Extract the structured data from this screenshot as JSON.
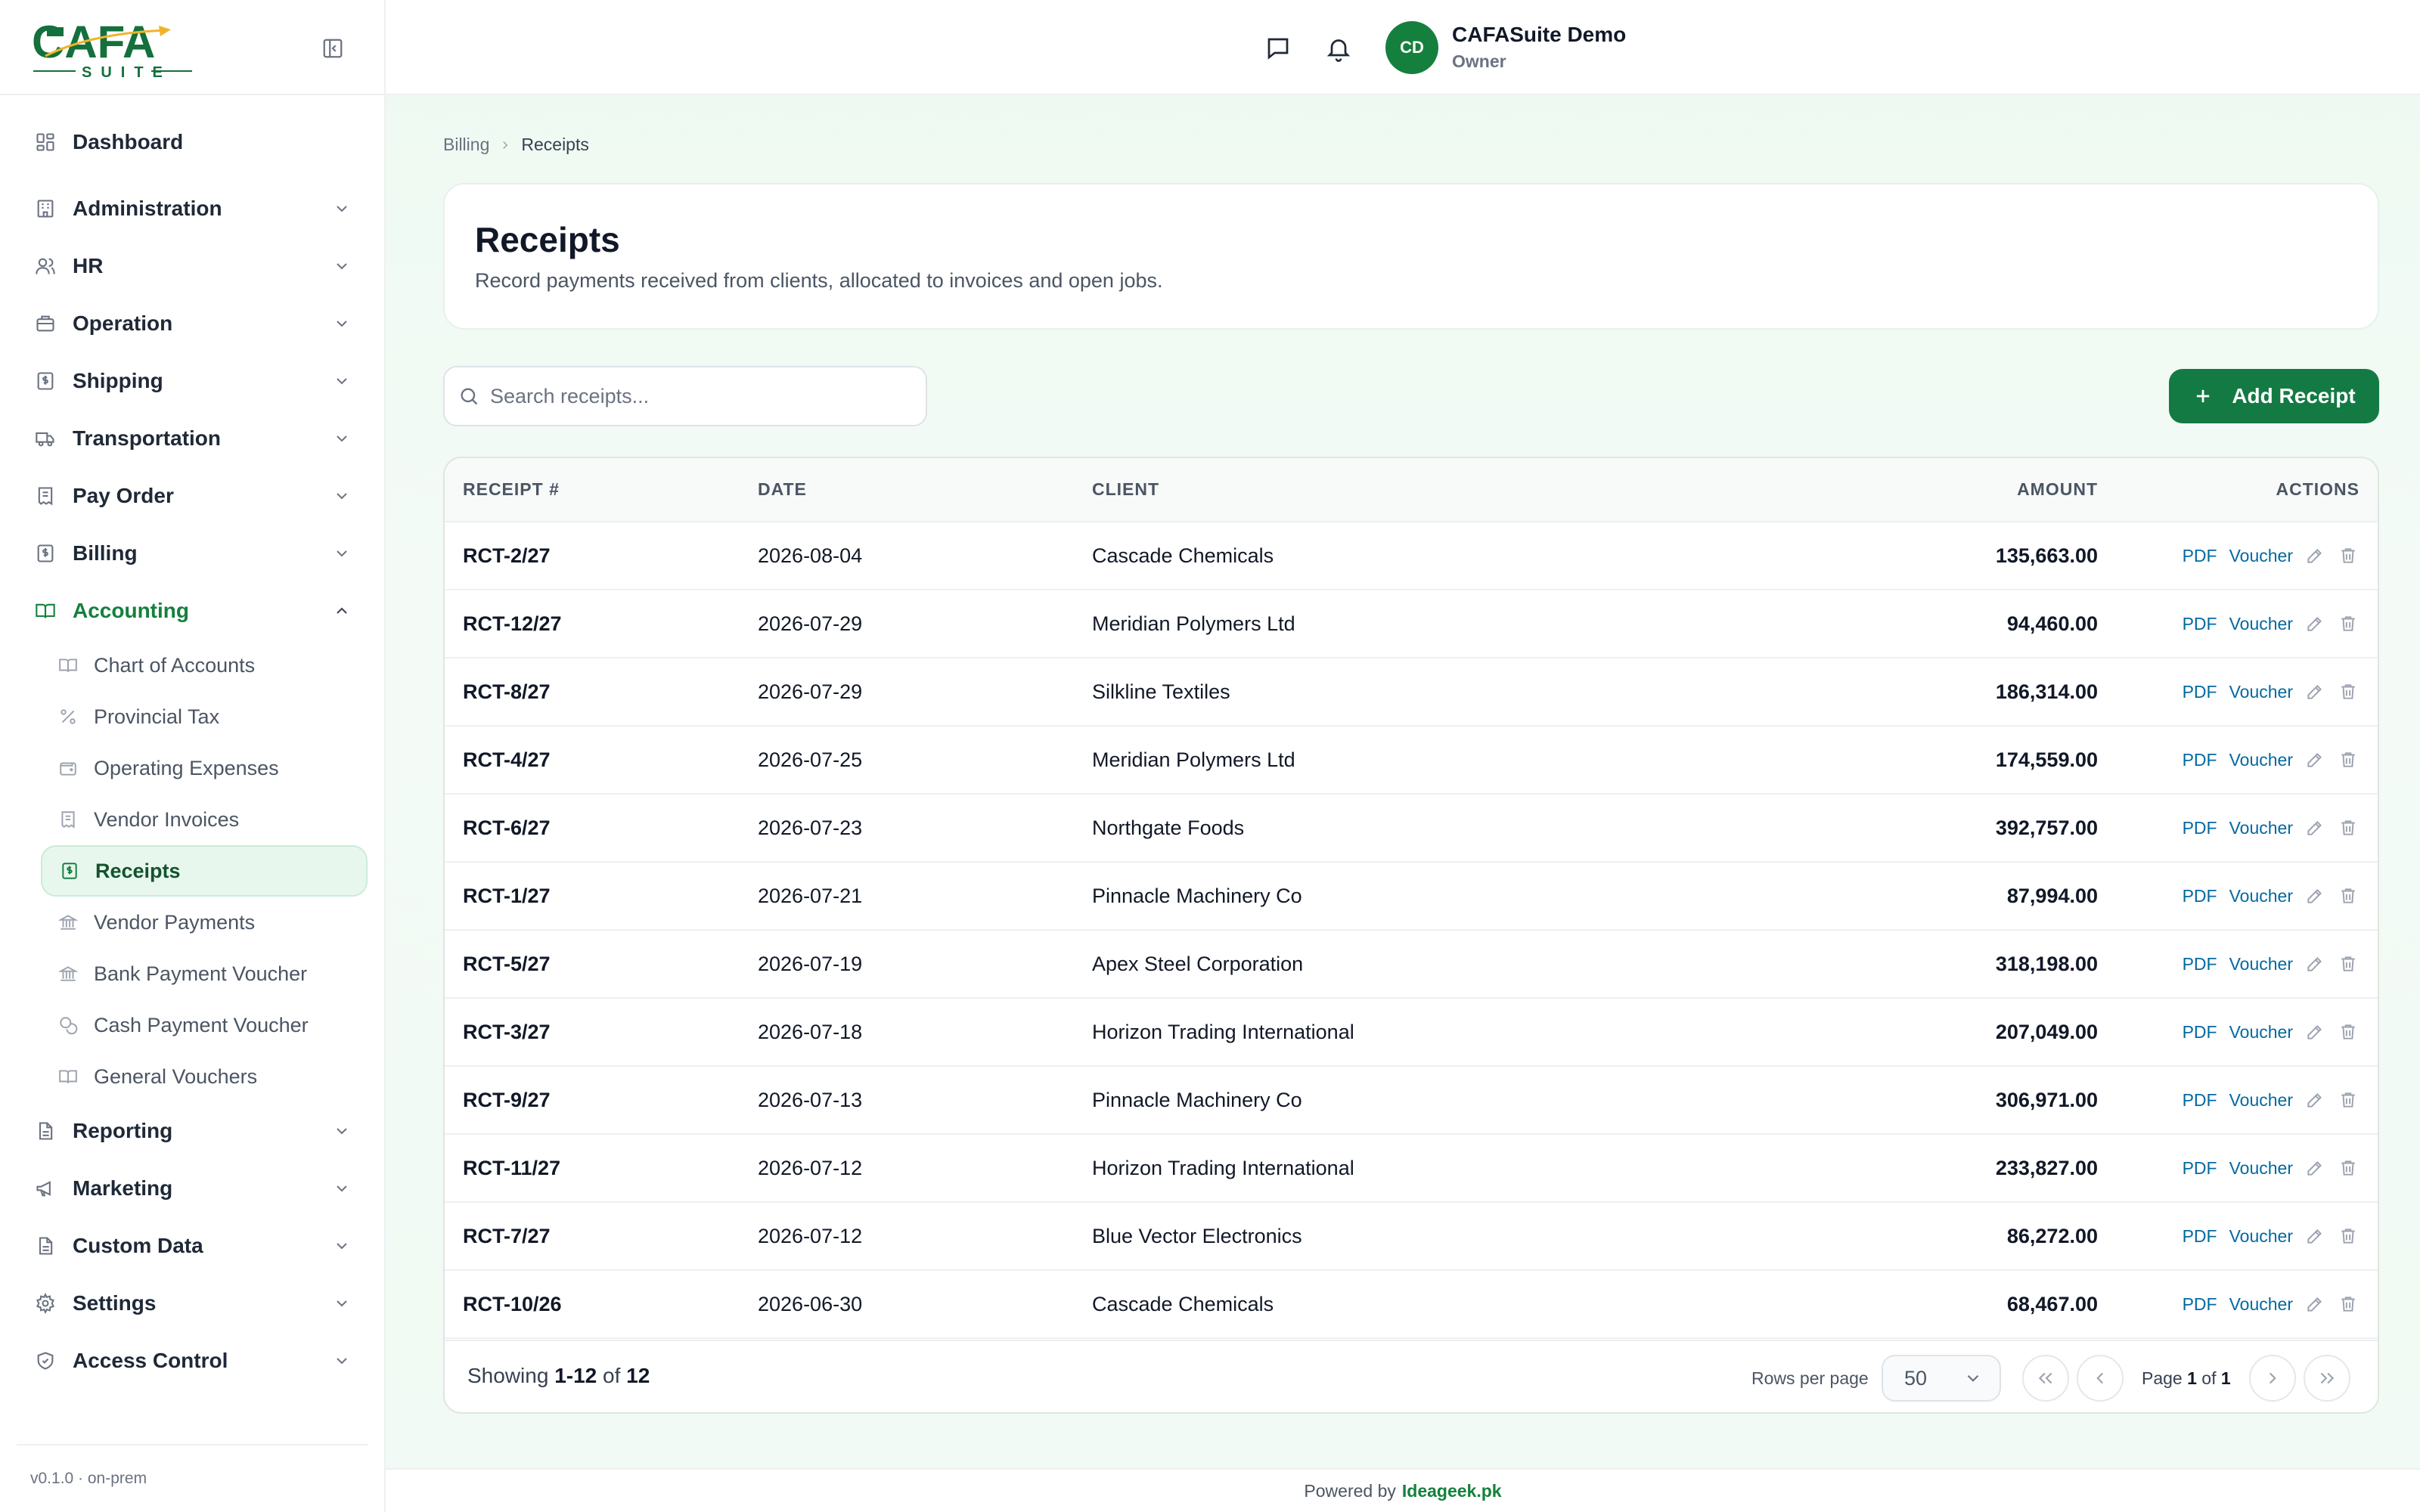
{
  "app": {
    "logo_text": "CAFA",
    "logo_sub": "SUITE",
    "version": "v0.1.0 · on-prem",
    "colors": {
      "brand": "#15803d",
      "button": "#137a43",
      "link": "#0369a1",
      "active_bg": "#e8f7ee"
    }
  },
  "sidebar": {
    "items": [
      {
        "label": "Dashboard",
        "icon": "dashboard-icon",
        "expandable": false
      },
      {
        "label": "Administration",
        "icon": "building-icon",
        "expandable": true
      },
      {
        "label": "HR",
        "icon": "users-icon",
        "expandable": true
      },
      {
        "label": "Operation",
        "icon": "briefcase-icon",
        "expandable": true
      },
      {
        "label": "Shipping",
        "icon": "document-dollar-icon",
        "expandable": true
      },
      {
        "label": "Transportation",
        "icon": "truck-icon",
        "expandable": true
      },
      {
        "label": "Pay Order",
        "icon": "receipt-icon",
        "expandable": true
      },
      {
        "label": "Billing",
        "icon": "document-dollar-icon",
        "expandable": true
      },
      {
        "label": "Accounting",
        "icon": "book-icon",
        "expandable": true,
        "open": true
      }
    ],
    "accounting_sub": [
      {
        "label": "Chart of Accounts",
        "icon": "book-icon"
      },
      {
        "label": "Provincial Tax",
        "icon": "percent-icon"
      },
      {
        "label": "Operating Expenses",
        "icon": "wallet-icon"
      },
      {
        "label": "Vendor Invoices",
        "icon": "receipt-icon"
      },
      {
        "label": "Receipts",
        "icon": "document-dollar-icon",
        "active": true
      },
      {
        "label": "Vendor Payments",
        "icon": "bank-icon"
      },
      {
        "label": "Bank Payment Voucher",
        "icon": "bank-icon"
      },
      {
        "label": "Cash Payment Voucher",
        "icon": "coins-icon"
      },
      {
        "label": "General Vouchers",
        "icon": "book-icon"
      }
    ],
    "items_after": [
      {
        "label": "Reporting",
        "icon": "document-icon"
      },
      {
        "label": "Marketing",
        "icon": "megaphone-icon"
      },
      {
        "label": "Custom Data",
        "icon": "document-icon"
      },
      {
        "label": "Settings",
        "icon": "gear-icon"
      },
      {
        "label": "Access Control",
        "icon": "shield-icon"
      }
    ]
  },
  "topbar": {
    "avatar_initials": "CD",
    "user_name": "CAFASuite Demo",
    "user_role": "Owner"
  },
  "breadcrumb": {
    "parent": "Billing",
    "current": "Receipts"
  },
  "header": {
    "title": "Receipts",
    "subtitle": "Record payments received from clients, allocated to invoices and open jobs."
  },
  "toolbar": {
    "search_placeholder": "Search receipts...",
    "add_label": "Add Receipt"
  },
  "table": {
    "columns": [
      "RECEIPT #",
      "DATE",
      "CLIENT",
      "AMOUNT",
      "ACTIONS"
    ],
    "action_pdf": "PDF",
    "action_voucher": "Voucher",
    "rows": [
      {
        "receipt": "RCT-2/27",
        "date": "2026-08-04",
        "client": "Cascade Chemicals",
        "amount": "135,663.00"
      },
      {
        "receipt": "RCT-12/27",
        "date": "2026-07-29",
        "client": "Meridian Polymers Ltd",
        "amount": "94,460.00"
      },
      {
        "receipt": "RCT-8/27",
        "date": "2026-07-29",
        "client": "Silkline Textiles",
        "amount": "186,314.00"
      },
      {
        "receipt": "RCT-4/27",
        "date": "2026-07-25",
        "client": "Meridian Polymers Ltd",
        "amount": "174,559.00"
      },
      {
        "receipt": "RCT-6/27",
        "date": "2026-07-23",
        "client": "Northgate Foods",
        "amount": "392,757.00"
      },
      {
        "receipt": "RCT-1/27",
        "date": "2026-07-21",
        "client": "Pinnacle Machinery Co",
        "amount": "87,994.00"
      },
      {
        "receipt": "RCT-5/27",
        "date": "2026-07-19",
        "client": "Apex Steel Corporation",
        "amount": "318,198.00"
      },
      {
        "receipt": "RCT-3/27",
        "date": "2026-07-18",
        "client": "Horizon Trading International",
        "amount": "207,049.00"
      },
      {
        "receipt": "RCT-9/27",
        "date": "2026-07-13",
        "client": "Pinnacle Machinery Co",
        "amount": "306,971.00"
      },
      {
        "receipt": "RCT-11/27",
        "date": "2026-07-12",
        "client": "Horizon Trading International",
        "amount": "233,827.00"
      },
      {
        "receipt": "RCT-7/27",
        "date": "2026-07-12",
        "client": "Blue Vector Electronics",
        "amount": "86,272.00"
      },
      {
        "receipt": "RCT-10/26",
        "date": "2026-06-30",
        "client": "Cascade Chemicals",
        "amount": "68,467.00"
      }
    ]
  },
  "pagination": {
    "showing_prefix": "Showing ",
    "showing_range": "1-12",
    "showing_of": " of ",
    "showing_total": "12",
    "rows_per_page_label": "Rows per page",
    "rows_per_page": "50",
    "page_prefix": "Page ",
    "page_current": "1",
    "page_of": " of ",
    "page_total": "1"
  },
  "footer": {
    "prefix": "Powered by",
    "brand": "Ideageek.pk"
  }
}
